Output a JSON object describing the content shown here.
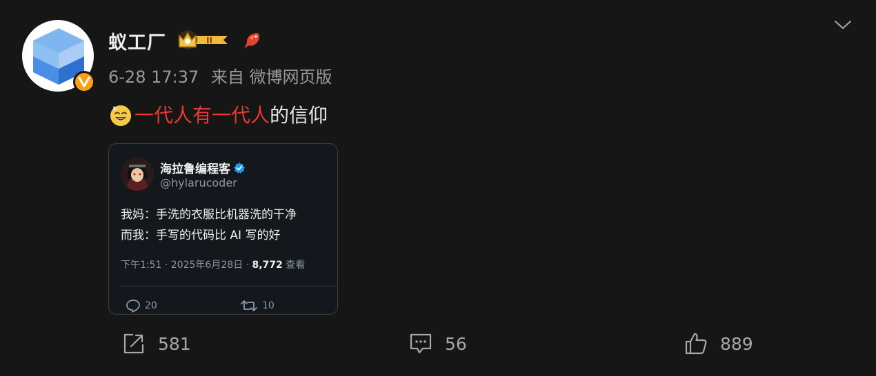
{
  "post": {
    "username": "蚁工厂",
    "time": "6-28 17:37",
    "source": "来自 微博网页版",
    "text_topic": "一代人有一代人",
    "text_rest": "的信仰",
    "icons": {
      "avatar": "blue-cube-logo",
      "verified": "orange-v-badge",
      "member": "crown-level-badge",
      "fan": "koi-fish-icon",
      "emoji": "grinning-sweat-emoji",
      "menu": "chevron-down-icon"
    }
  },
  "quoted": {
    "name": "海拉鲁编程客",
    "handle": "@hylarucoder",
    "lines": [
      "我妈：手洗的衣服比机器洗的干净",
      "而我：手写的代码比 AI 写的好"
    ],
    "meta_prefix": "下午1:51 · 2025年6月28日 · ",
    "views": "8,772",
    "views_label": " 查看",
    "replies": "20",
    "retweets": "10",
    "member_badge_text": "II"
  },
  "actions": {
    "share": "581",
    "comment": "56",
    "like": "889"
  },
  "colors": {
    "background": "#161616",
    "topic": "#e53a35",
    "badge": "#f7a11b",
    "verified_blue": "#1d9bf0"
  }
}
